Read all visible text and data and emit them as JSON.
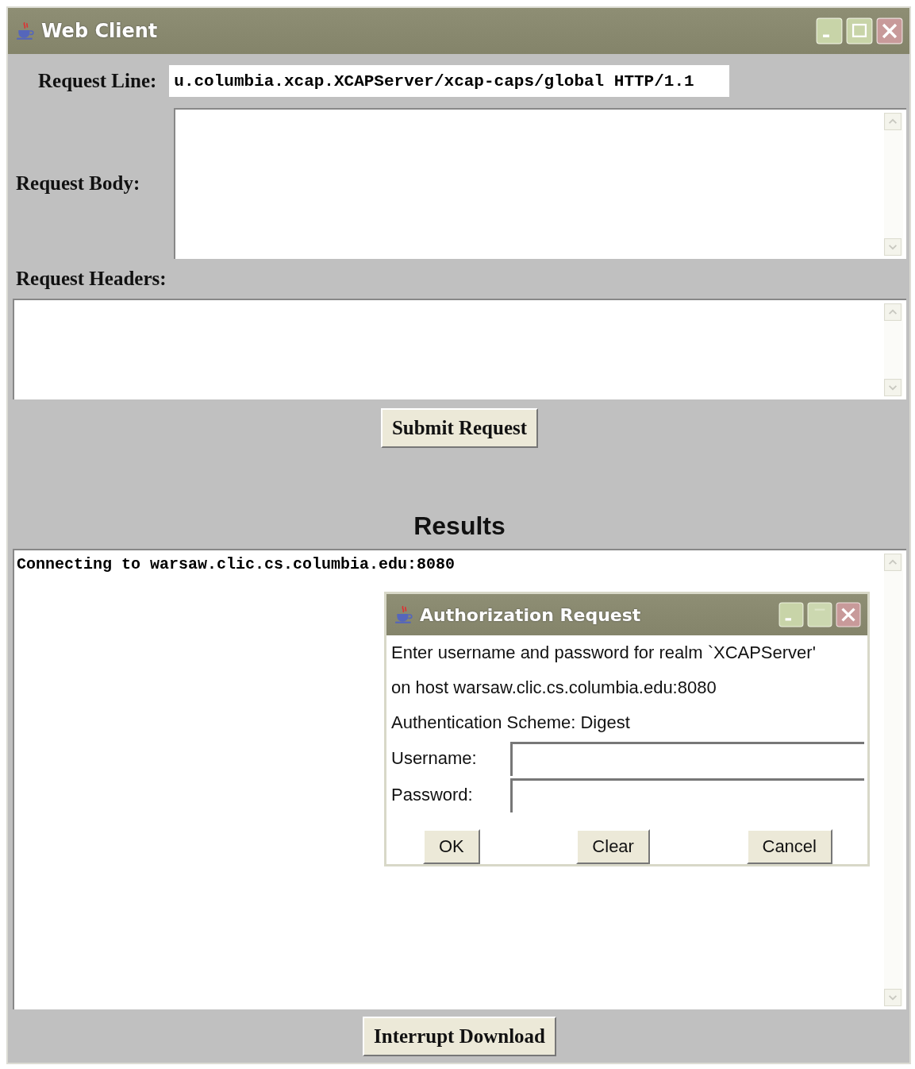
{
  "window": {
    "title": "Web Client"
  },
  "request_line": {
    "label": "Request Line:",
    "value": "u.columbia.xcap.XCAPServer/xcap-caps/global HTTP/1.1"
  },
  "request_body": {
    "label": "Request Body:"
  },
  "request_headers": {
    "label": "Request Headers:"
  },
  "submit_button": "Submit Request",
  "results": {
    "heading": "Results",
    "text": "Connecting to warsaw.clic.cs.columbia.edu:8080"
  },
  "dialog": {
    "title": "Authorization Request",
    "lines": [
      "Enter username and password for realm `XCAPServer'",
      "on host warsaw.clic.cs.columbia.edu:8080",
      "Authentication Scheme: Digest"
    ],
    "fields": [
      {
        "label": "Username:"
      },
      {
        "label": "Password:"
      }
    ],
    "buttons": [
      "OK",
      "Clear",
      "Cancel"
    ]
  },
  "interrupt_button": "Interrupt Download"
}
